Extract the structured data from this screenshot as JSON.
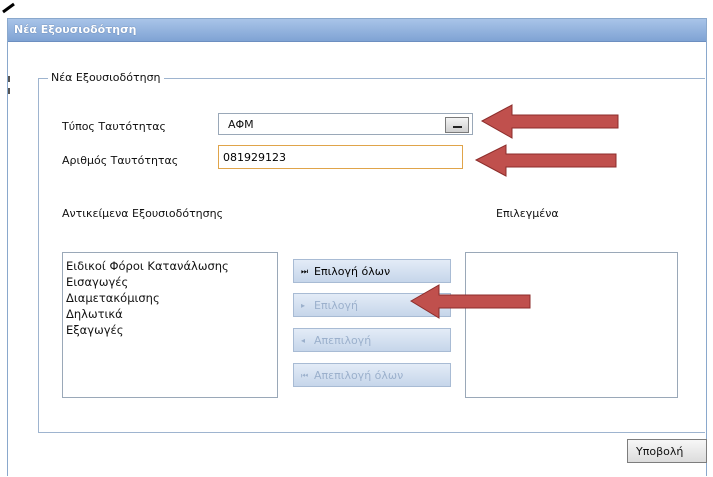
{
  "window": {
    "title": "Νέα Εξουσιοδότηση"
  },
  "form": {
    "legend": "Νέα Εξουσιοδότηση",
    "id_type": {
      "label": "Τύπος Ταυτότητας",
      "value": "ΑΦΜ"
    },
    "id_number": {
      "label": "Αριθμός Ταυτότητας",
      "value": "081929123"
    }
  },
  "lists": {
    "available_title": "Αντικείμενα Εξουσιοδότησης",
    "selected_title": "Επιλεγμένα",
    "available_items": [
      "Ειδικοί Φόροι Κατανάλωσης",
      "Εισαγωγές",
      "Διαμετακόμισης",
      "Δηλωτικά",
      "Εξαγωγές"
    ],
    "selected_items": []
  },
  "buttons": {
    "select_all": "Επιλογή όλων",
    "select": "Επιλογή",
    "deselect": "Απεπιλογή",
    "deselect_all": "Απεπιλογή όλων",
    "submit": "Υποβολή"
  },
  "colors": {
    "annotation_arrow": "#c0504d",
    "title_bar": "#8fb0dc"
  }
}
